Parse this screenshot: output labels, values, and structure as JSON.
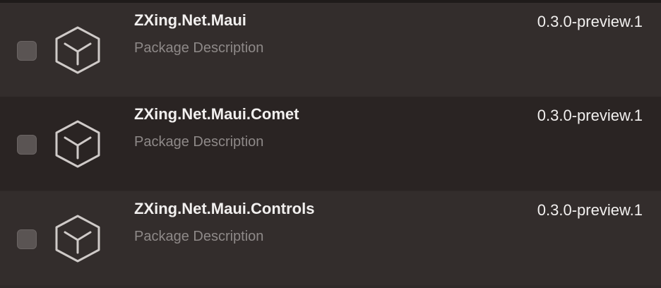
{
  "colors": {
    "background": "#2f2a29",
    "row_bg": "#332d2c",
    "row_alt_bg": "#2a2423",
    "title": "#f2f0ef",
    "description": "#8e8988",
    "icon_stroke": "#cfcac8"
  },
  "packages": [
    {
      "name": "ZXing.Net.Maui",
      "description": "Package Description",
      "version": "0.3.0-preview.1",
      "checked": false,
      "icon": "package-cube-icon"
    },
    {
      "name": "ZXing.Net.Maui.Comet",
      "description": "Package Description",
      "version": "0.3.0-preview.1",
      "checked": false,
      "icon": "package-cube-icon"
    },
    {
      "name": "ZXing.Net.Maui.Controls",
      "description": "Package Description",
      "version": "0.3.0-preview.1",
      "checked": false,
      "icon": "package-cube-icon"
    }
  ]
}
